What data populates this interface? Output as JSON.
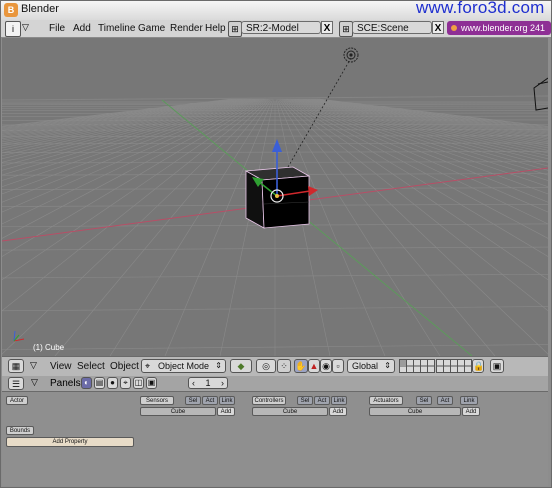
{
  "window": {
    "title": "Blender",
    "app_icon_glyph": "B"
  },
  "watermark": "www.foro3d.com",
  "menubar": {
    "menus": [
      "File",
      "Add",
      "Timeline",
      "Game",
      "Render",
      "Help"
    ],
    "screen_field": "SR:2-Model",
    "scene_field": "SCE:Scene",
    "close_glyph": "X",
    "url_badge": "www.blender.org 241"
  },
  "viewport": {
    "object_label": "(1) Cube",
    "axis_glyphs": {
      "z": "z",
      "y": "y",
      "x": "x"
    },
    "colors": {
      "background": "#777777",
      "grid": "#868686",
      "x_axis": "#c0506a",
      "y_axis": "#5b9b5a"
    }
  },
  "header3d": {
    "view": "View",
    "select": "Select",
    "object": "Object",
    "mode": "Object Mode",
    "orientation": "Global"
  },
  "buttons_window": {
    "panels_label": "Panels",
    "frame": "1",
    "actor": "Actor",
    "bounds": "Bounds",
    "add_property": "Add Property",
    "sensors": {
      "title": "Sensors",
      "toggles": [
        "Sel",
        "Act",
        "Link"
      ],
      "object": "Cube",
      "add": "Add"
    },
    "controllers": {
      "title": "Controllers",
      "toggles": [
        "Sel",
        "Act",
        "Link"
      ],
      "object": "Cube",
      "add": "Add"
    },
    "actuators": {
      "title": "Actuators",
      "toggles": [
        "Sel",
        "Act",
        "Link"
      ],
      "object": "Cube",
      "add": "Add"
    }
  }
}
